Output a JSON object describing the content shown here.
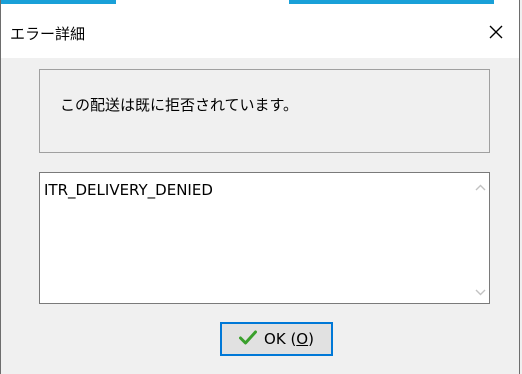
{
  "window": {
    "title": "エラー詳細",
    "close_icon": "close-icon"
  },
  "message": {
    "text": "この配送は既に拒否されています。"
  },
  "details": {
    "text": "ITR_DELIVERY_DENIED",
    "scroll_up_icon": "chevron-up-icon",
    "scroll_down_icon": "chevron-down-icon"
  },
  "ok_button": {
    "label_prefix": "OK (",
    "mnemonic": "O",
    "label_suffix": ")",
    "icon": "check-icon"
  },
  "colors": {
    "accent": "#19a0d8",
    "focus_border": "#0078d7",
    "check_green": "#3aa02c",
    "button_face": "#e1e1e1",
    "window_bg": "#f0f0f0"
  }
}
